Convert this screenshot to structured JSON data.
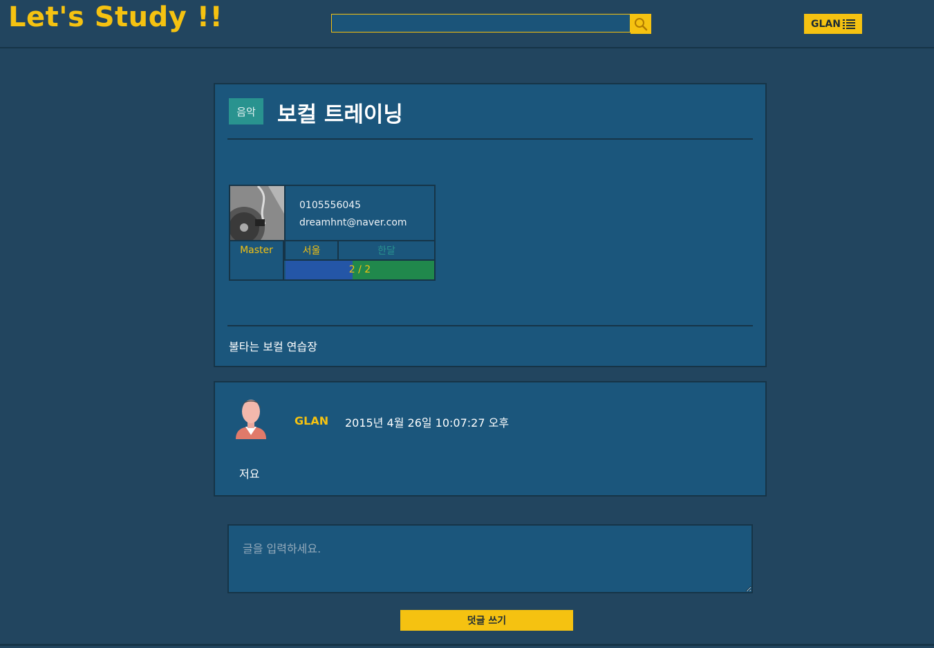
{
  "header": {
    "logo": "Let's Study !!",
    "search": {
      "value": "",
      "placeholder": ""
    },
    "user_button": {
      "label": "GLAN",
      "icon": "list-icon"
    }
  },
  "post": {
    "category": "음악",
    "title": "보컬 트레이닝",
    "profile": {
      "phone": "0105556045",
      "email": "dreamhnt@naver.com",
      "role": "Master",
      "location": "서울",
      "duration": "한달",
      "members": "2 / 2",
      "members_fraction": 0.45
    },
    "description": "불타는 보컬 연습장"
  },
  "comments": [
    {
      "author": "GLAN",
      "date": "2015년 4월 26일 10:07:27 오후",
      "text": "저요"
    }
  ],
  "comment_form": {
    "placeholder": "글을 입력하세요.",
    "submit_label": "덧글 쓰기"
  },
  "colors": {
    "background": "#22455f",
    "card": "#1b567c",
    "accent": "#f5c211",
    "category_badge": "#29938f",
    "bar_blue": "#2456a7",
    "bar_green": "#20884c"
  }
}
